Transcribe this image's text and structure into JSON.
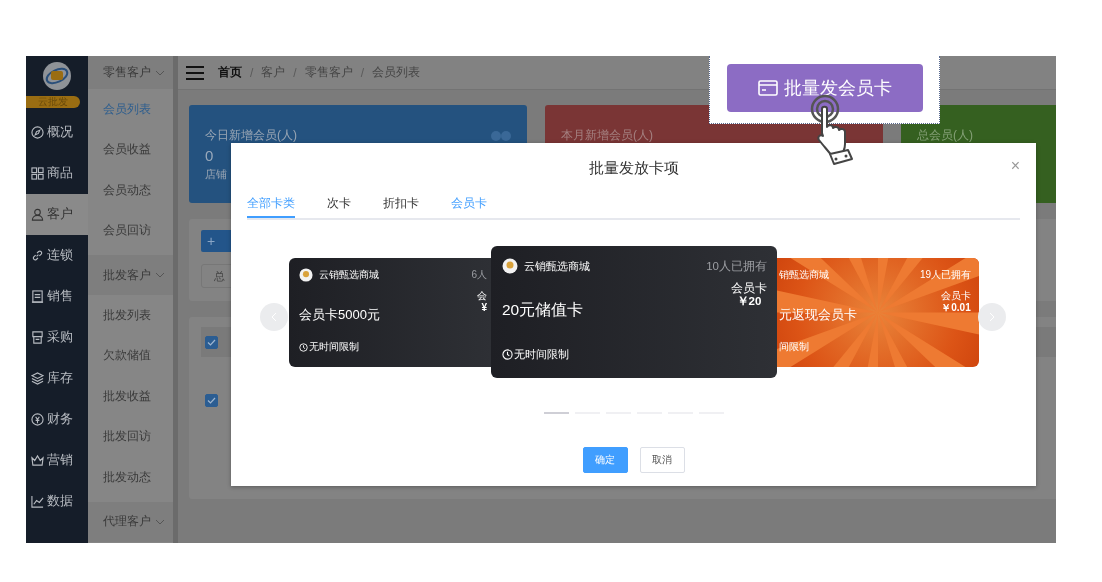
{
  "sidebar": {
    "badge": "云批发",
    "items": [
      {
        "label": "概况",
        "selected": false
      },
      {
        "label": "商品",
        "selected": false
      },
      {
        "label": "客户",
        "selected": true
      },
      {
        "label": "连锁",
        "selected": false
      },
      {
        "label": "销售",
        "selected": false
      },
      {
        "label": "采购",
        "selected": false
      },
      {
        "label": "库存",
        "selected": false
      },
      {
        "label": "财务",
        "selected": false
      },
      {
        "label": "营销",
        "selected": false
      },
      {
        "label": "数据",
        "selected": false
      }
    ]
  },
  "submenu": [
    {
      "label": "零售客户",
      "children": [
        {
          "label": "会员列表",
          "selected": true
        },
        {
          "label": "会员收益",
          "selected": false
        },
        {
          "label": "会员动态",
          "selected": false
        },
        {
          "label": "会员回访",
          "selected": false
        }
      ]
    },
    {
      "label": "批发客户",
      "children": [
        {
          "label": "批发列表",
          "selected": false
        },
        {
          "label": "欠款储值",
          "selected": false
        },
        {
          "label": "批发收益",
          "selected": false
        },
        {
          "label": "批发回访",
          "selected": false
        },
        {
          "label": "批发动态",
          "selected": false
        }
      ]
    },
    {
      "label": "代理客户"
    }
  ],
  "breadcrumb": [
    {
      "label": "首页"
    },
    {
      "separator": "/",
      "label": "客户"
    },
    {
      "separator": "/",
      "label": "零售客户"
    },
    {
      "separator": "/",
      "label": "会员列表"
    }
  ],
  "stats": [
    {
      "label": "今日新增会员(人)",
      "value": "0",
      "note": "店铺",
      "color": "#24527f"
    },
    {
      "label": "本月新增会员(人)",
      "color": "#7a3535"
    },
    {
      "label": "总会员(人)",
      "color": "#356020"
    }
  ],
  "toolbar": {
    "add_button": "+",
    "store_field": "总"
  },
  "table": {
    "rows": [
      {
        "checked": true
      },
      {
        "checked": true
      }
    ]
  },
  "modal": {
    "title": "批量发放卡项",
    "close": "×",
    "tabs": [
      {
        "label": "全部卡类",
        "selected": true,
        "hovered": false
      },
      {
        "label": "次卡",
        "selected": false,
        "hovered": false
      },
      {
        "label": "折扣卡",
        "selected": false,
        "hovered": false
      },
      {
        "label": "会员卡",
        "selected": false,
        "hovered": true
      }
    ],
    "cards": [
      {
        "kind": "dark",
        "shop": "云销甄选商城",
        "owned": "6人",
        "type": "会",
        "price": "¥",
        "title": "会员卡5000元",
        "limit": "无时间限制",
        "selected": false
      },
      {
        "kind": "dark",
        "shop": "云销甄选商城",
        "owned": "10人已拥有",
        "type": "会员卡",
        "price": "￥20",
        "title": "20元储值卡",
        "limit": "无时间限制",
        "selected": true
      },
      {
        "kind": "sunburst",
        "shop": "销甄选商城",
        "owned": "19人已拥有",
        "type": "会员卡",
        "price": "￥0.01",
        "title": "元返现会员卡",
        "limit": "间限制",
        "selected": false
      }
    ],
    "indicators": [
      {
        "selected": true
      },
      {
        "selected": false
      },
      {
        "selected": false
      },
      {
        "selected": false
      },
      {
        "selected": false
      },
      {
        "selected": false
      }
    ],
    "buttons": [
      {
        "label": "确定",
        "kind": "primary"
      },
      {
        "label": "取消",
        "kind": "default"
      }
    ]
  },
  "callout": {
    "button": "批量发会员卡"
  }
}
